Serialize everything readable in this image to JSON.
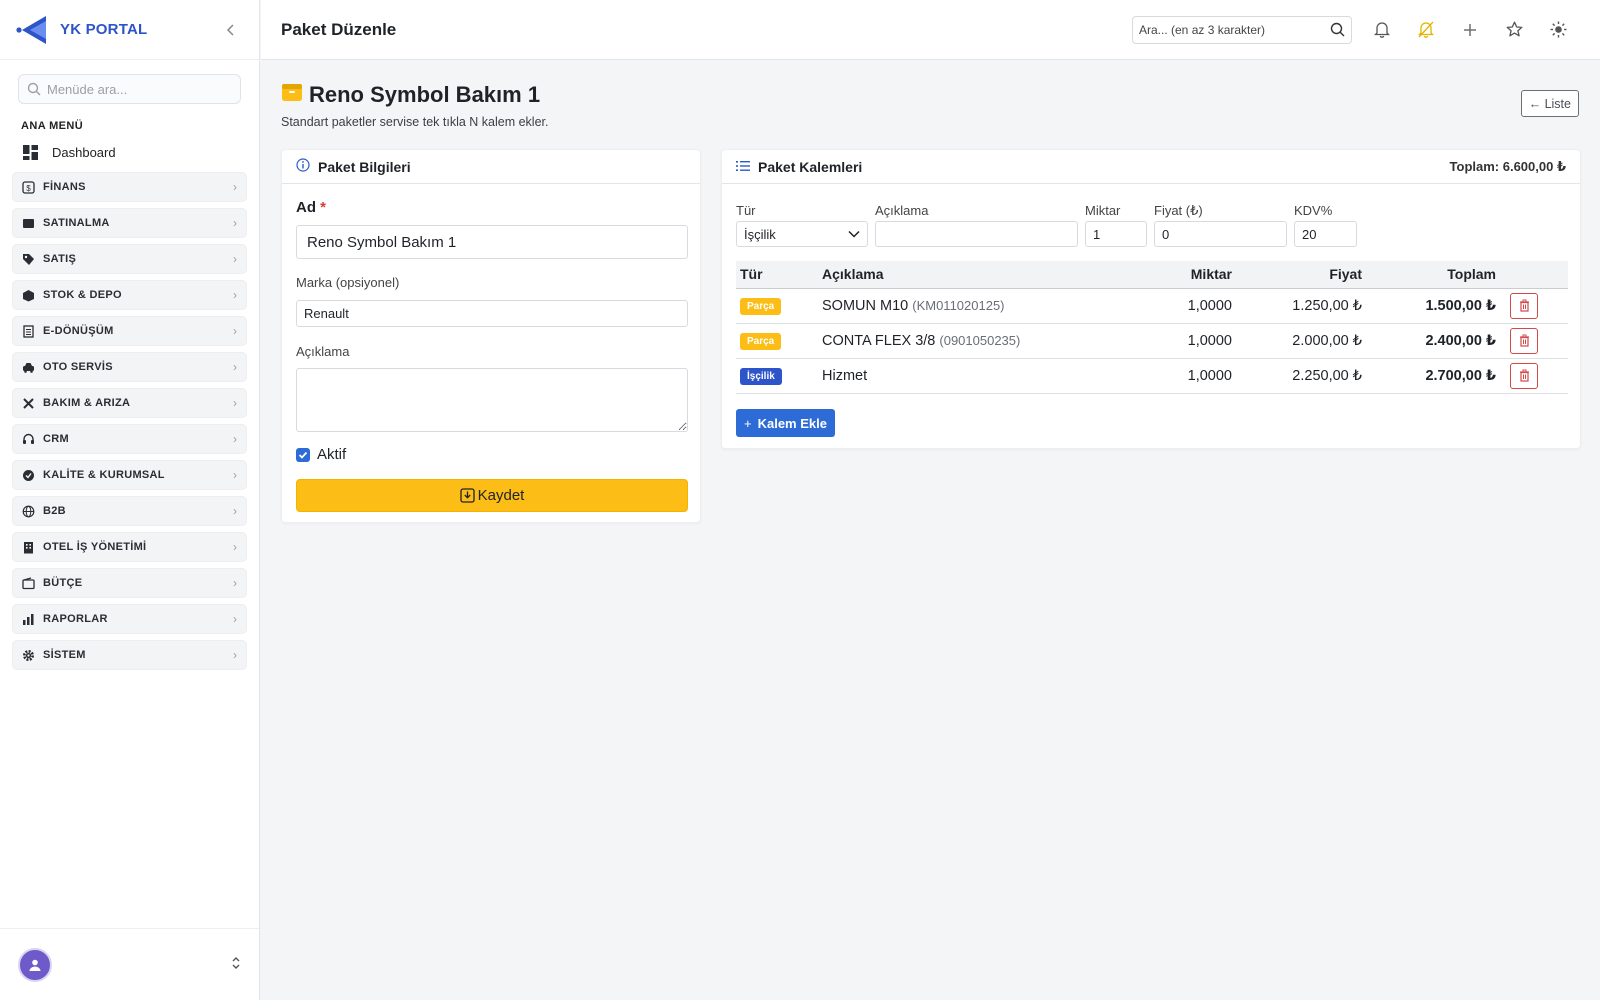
{
  "brand": {
    "name": "YK PORTAL"
  },
  "sidebar": {
    "search_placeholder": "Menüde ara...",
    "heading": "ANA MENÜ",
    "dashboard_label": "Dashboard",
    "items": [
      {
        "label": "FİNANS",
        "icon": "finance-icon"
      },
      {
        "label": "SATINALMA",
        "icon": "cart-icon"
      },
      {
        "label": "SATIŞ",
        "icon": "tag-icon"
      },
      {
        "label": "STOK & DEPO",
        "icon": "box-icon"
      },
      {
        "label": "E-DÖNÜŞÜM",
        "icon": "document-icon"
      },
      {
        "label": "OTO SERVİS",
        "icon": "car-icon"
      },
      {
        "label": "BAKIM & ARIZA",
        "icon": "tools-icon"
      },
      {
        "label": "CRM",
        "icon": "headset-icon"
      },
      {
        "label": "KALİTE & KURUMSAL",
        "icon": "badge-icon"
      },
      {
        "label": "B2B",
        "icon": "globe-icon"
      },
      {
        "label": "OTEL İŞ YÖNETİMİ",
        "icon": "building-icon"
      },
      {
        "label": "BÜTÇE",
        "icon": "wallet-icon"
      },
      {
        "label": "RAPORLAR",
        "icon": "bar-chart-icon"
      },
      {
        "label": "SİSTEM",
        "icon": "gear-icon"
      }
    ]
  },
  "topbar": {
    "title": "Paket Düzenle",
    "search_placeholder": "Ara... (en az 3 karakter)"
  },
  "page": {
    "title": "Reno Symbol Bakım 1",
    "subtitle": "Standart paketler servise tek tıkla N kalem ekler.",
    "back_label": "← Liste"
  },
  "info_card": {
    "title": "Paket Bilgileri",
    "name_label": "Ad",
    "name_required": "*",
    "name_value": "Reno Symbol Bakım 1",
    "brand_label": "Marka (opsiyonel)",
    "brand_value": "Renault",
    "desc_label": "Açıklama",
    "desc_value": "",
    "active_label": "Aktif",
    "active_checked": true,
    "save_label": "Kaydet"
  },
  "items_card": {
    "title": "Paket Kalemleri",
    "total_label": "Toplam: 6.600,00 ₺",
    "form": {
      "type_label": "Tür",
      "type_value": "İşçilik",
      "desc_label": "Açıklama",
      "desc_value": "",
      "qty_label": "Miktar",
      "qty_value": "1",
      "price_label": "Fiyat (₺)",
      "price_value": "0",
      "vat_label": "KDV%",
      "vat_value": "20"
    },
    "columns": [
      "Tür",
      "Açıklama",
      "Miktar",
      "Fiyat",
      "Toplam"
    ],
    "rows": [
      {
        "type": "Parça",
        "kind": "parca",
        "desc": "SOMUN M10",
        "code": "(KM011020125)",
        "qty": "1,0000",
        "price": "1.250,00 ₺",
        "total": "1.500,00 ₺"
      },
      {
        "type": "Parça",
        "kind": "parca",
        "desc": "CONTA FLEX 3/8",
        "code": "(0901050235)",
        "qty": "1,0000",
        "price": "2.000,00 ₺",
        "total": "2.400,00 ₺"
      },
      {
        "type": "İşçilik",
        "kind": "iscilik",
        "desc": "Hizmet",
        "code": "",
        "qty": "1,0000",
        "price": "2.250,00 ₺",
        "total": "2.700,00 ₺"
      }
    ],
    "add_label": "Kalem Ekle"
  },
  "colors": {
    "brand_blue": "#2d54c8",
    "accent_yellow": "#fbbd16",
    "primary_blue": "#2d6bd6",
    "danger_red": "#d64848"
  }
}
